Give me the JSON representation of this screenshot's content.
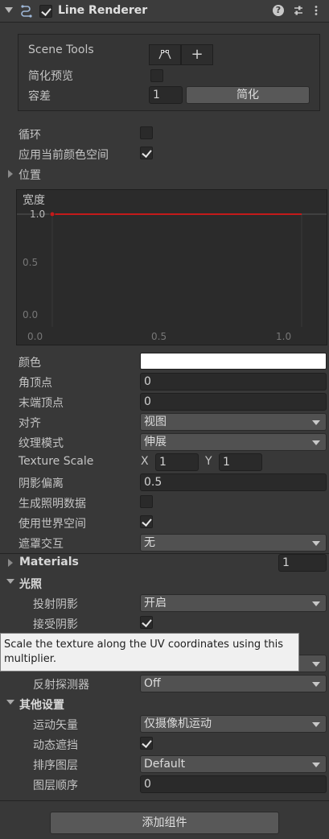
{
  "header": {
    "title": "Line Renderer",
    "enabled": true,
    "icons": [
      "line-renderer-icon",
      "help-icon",
      "presets-icon",
      "more-icon"
    ]
  },
  "scene_tools": {
    "label": "Scene Tools",
    "tools": [
      "edit-points-icon",
      "create-points-icon"
    ],
    "simplify_preview_label": "简化预览",
    "simplify_preview": false,
    "tolerance_label": "容差",
    "tolerance_value": "1",
    "simplify_button": "简化"
  },
  "loop": {
    "label": "循环",
    "checked": false
  },
  "apply_color_space": {
    "label": "应用当前颜色空间",
    "checked": true
  },
  "positions": {
    "label": "位置"
  },
  "width_curve": {
    "label": "宽度",
    "y_ticks": [
      "1.0",
      "0.5",
      "0.0"
    ],
    "x_ticks": [
      "0.0",
      "0.5",
      "1.0"
    ],
    "value": 1.0,
    "line_color": "#c41a1a"
  },
  "fields": {
    "color": {
      "label": "颜色",
      "value_color": "#ffffff"
    },
    "corner_vertices": {
      "label": "角顶点",
      "value": "0"
    },
    "end_cap_vertices": {
      "label": "末端顶点",
      "value": "0"
    },
    "alignment": {
      "label": "对齐",
      "value": "视图"
    },
    "texture_mode": {
      "label": "纹理模式",
      "value": "伸展"
    },
    "texture_scale": {
      "label": "Texture Scale",
      "x_label": "X",
      "x": "1",
      "y_label": "Y",
      "y": "1"
    },
    "shadow_bias": {
      "label": "阴影偏离",
      "value": "0.5"
    },
    "generate_lighting_data": {
      "label": "生成照明数据",
      "checked": false
    },
    "use_world_space": {
      "label": "使用世界空间",
      "checked": true
    },
    "mask_interaction": {
      "label": "遮罩交互",
      "value": "无"
    }
  },
  "materials": {
    "label": "Materials",
    "count": "1"
  },
  "lighting": {
    "label": "光照",
    "cast_shadows": {
      "label": "投射阴影",
      "value": "开启"
    },
    "receive_shadows": {
      "label": "接受阴影",
      "checked": true
    }
  },
  "tooltip": {
    "text": "Scale the texture along the UV coordinates using this multiplier."
  },
  "probes": {
    "reflection_probes": {
      "label": "反射探测器",
      "value": "Off"
    }
  },
  "additional_settings": {
    "label": "其他设置",
    "motion_vectors": {
      "label": "运动矢量",
      "value": "仅摄像机运动"
    },
    "dynamic_occlusion": {
      "label": "动态遮挡",
      "checked": true
    },
    "sorting_layer": {
      "label": "排序图层",
      "value": "Default"
    },
    "order_in_layer": {
      "label": "图层顺序",
      "value": "0"
    }
  },
  "add_component": "添加组件"
}
